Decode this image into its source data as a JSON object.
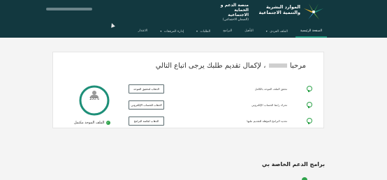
{
  "header": {
    "org_name": "الموارد البشرية والتنمية الاجتماعية",
    "platform_title": "منصة الدعم و الحماية الاجتماعية",
    "platform_subtitle": "(الضمان الاجتماعي)",
    "colors": {
      "background": "#12383f",
      "accent": "#1d8f78"
    }
  },
  "nav": {
    "items": [
      {
        "label": "الصفحة الرئيسية",
        "icon": ""
      },
      {
        "label": "الملف الفردي",
        "icon": "chevron-down-icon"
      },
      {
        "label": "التأهيل",
        "icon": ""
      },
      {
        "label": "البرامج",
        "icon": ""
      },
      {
        "label": "الطلبات",
        "icon": "chevron-down-icon"
      },
      {
        "label": "إدارة المرفقات",
        "icon": "chevron-down-icon"
      },
      {
        "label": "الاعتذار",
        "icon": ""
      }
    ]
  },
  "welcome": {
    "prefix": "مرحبا",
    "suffix": "، لإكمال تقديم طلبك يرجى اتباع التالي"
  },
  "steps": [
    {
      "text": "تحقق الملف الموحد بالكامل",
      "button": "الذهاب لتحقيق الموحد"
    },
    {
      "text": "تحرك رابط الحساب الإلكتروني",
      "button": "الذهاب للحساب الإلكتروني"
    },
    {
      "text": "تحديد البرامج المؤهلة للتقديم عليها",
      "button": "الذهاب لقائمة البرامج"
    }
  ],
  "profile_progress": {
    "percent_text": "100%",
    "percent": 100,
    "complete_label": "الملف الموحد مكتمل",
    "ring_color": "#1d8f78"
  },
  "section": {
    "title": "برامج الدعم الخاصة بي"
  }
}
